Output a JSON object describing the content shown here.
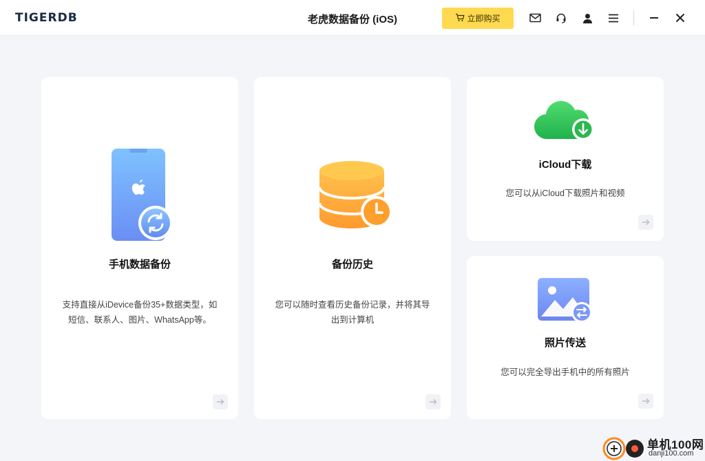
{
  "header": {
    "logo": "TIGERDB",
    "title": "老虎数据备份 (iOS)",
    "buy_label": "立即购买",
    "icons": [
      "mail-icon",
      "headset-icon",
      "user-icon",
      "menu-icon",
      "minimize-icon",
      "close-icon"
    ]
  },
  "cards": {
    "phone_backup": {
      "title": "手机数据备份",
      "desc_line1": "支持直接从iDevice备份35+数据类型，如",
      "desc_line2": "短信、联系人、图片、WhatsApp等。",
      "icon": "phone-sync-icon"
    },
    "backup_history": {
      "title": "备份历史",
      "desc_line1": "您可以随时查看历史备份记录，并将其导",
      "desc_line2": "出到计算机",
      "icon": "database-clock-icon"
    },
    "icloud_download": {
      "title": "iCloud下载",
      "desc": "您可以从iCloud下载照片和视频",
      "icon": "cloud-download-icon"
    },
    "photo_transfer": {
      "title": "照片传送",
      "desc": "您可以完全导出手机中的所有照片",
      "icon": "photo-transfer-icon"
    }
  },
  "watermark": {
    "site_name": "单机100网",
    "domain": "danji100.com"
  },
  "colors": {
    "accent_yellow": "#ffd94f",
    "card_bg": "#ffffff",
    "page_bg": "#f4f5f8",
    "phone_blue": "#6aa6f8",
    "database_orange": "#ffa733",
    "cloud_green": "#2fc25b",
    "photo_blue": "#7a98f5"
  }
}
